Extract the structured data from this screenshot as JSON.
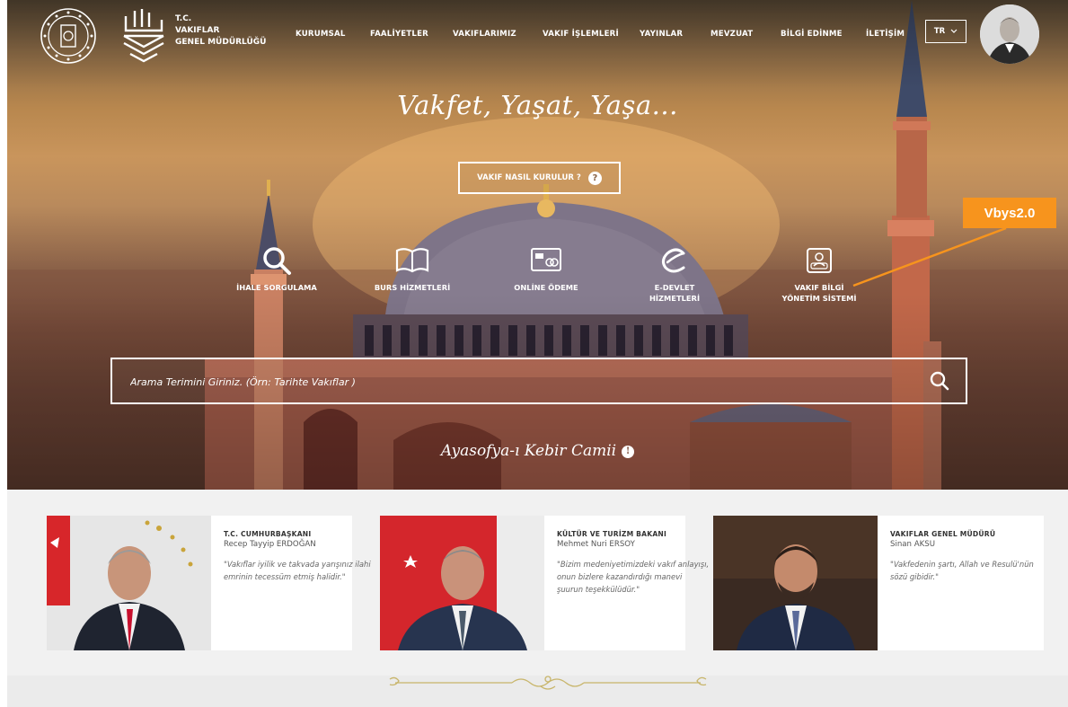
{
  "header": {
    "title_lines": [
      "T.C.",
      "VAKIFLAR",
      "GENEL MÜDÜRLÜĞÜ"
    ],
    "nav": [
      "KURUMSAL",
      "FAALİYETLER",
      "VAKIFLARIMIZ",
      "VAKIF İŞLEMLERİ",
      "YAYINLAR",
      "MEVZUAT",
      "BİLGİ EDİNME",
      "İLETİŞİM"
    ],
    "language": "TR"
  },
  "hero": {
    "slogan": "Vakfet, Yaşat, Yaşa...",
    "how_button": "VAKIF NASIL KURULUR ?",
    "how_button_icon": "?",
    "services": [
      {
        "label": "İHALE SORGULAMA",
        "icon": "search-icon"
      },
      {
        "label": "BURS HİZMETLERİ",
        "icon": "book-icon"
      },
      {
        "label": "ONLİNE ÖDEME",
        "icon": "card-payment-icon"
      },
      {
        "label": "E-DEVLET HİZMETLERİ",
        "icon": "e-devlet-icon"
      },
      {
        "label": "VAKIF BİLGİ YÖNETİM SİSTEMİ",
        "icon": "vbys-icon"
      }
    ],
    "search_placeholder": "Arama Terimini Giriniz. (Örn: Tarihte Vakıflar )",
    "caption": "Ayasofya-ı Kebir Camii"
  },
  "annotation": {
    "label": "Vbys2.0",
    "color": "#f7941d"
  },
  "officials": [
    {
      "role": "T.C. CUMHURBAŞKANI",
      "name": "Recep Tayyip ERDOĞAN",
      "quote": "\"Vakıflar iyilik ve takvada yarışınız ilahi emrinin tecessüm etmiş halidir.\""
    },
    {
      "role": "KÜLTÜR VE TURİZM BAKANI",
      "name": "Mehmet Nuri ERSOY",
      "quote": "\"Bizim medeniyetimizdeki vakıf anlayışı, onun bizlere kazandırdığı manevi şuurun teşekkülüdür.\""
    },
    {
      "role": "VAKIFLAR GENEL MÜDÜRÜ",
      "name": "Sinan AKSU",
      "quote": "\"Vakfedenin şartı, Allah ve Resulü'nün sözü gibidir.\""
    }
  ],
  "colors": {
    "accent": "#f7941d",
    "ornament": "#c8b56a"
  }
}
